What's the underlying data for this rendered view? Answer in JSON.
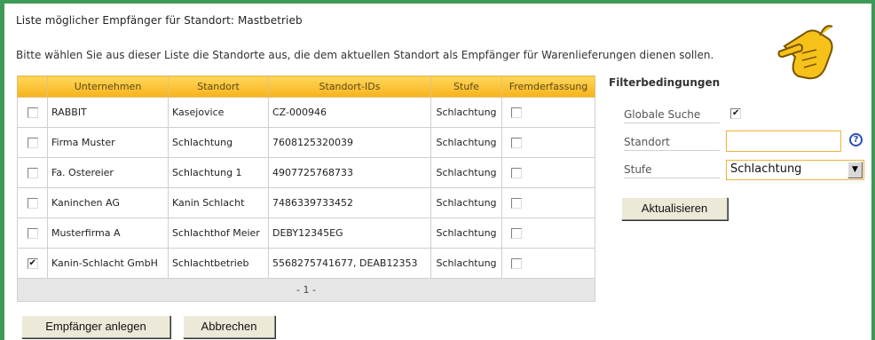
{
  "page": {
    "title": "Liste möglicher Empfänger für Standort: Mastbetrieb",
    "subtitle": "Bitte wählen Sie aus dieser Liste die Standorte aus, die dem aktuellen Standort als Empfänger für Warenlieferungen dienen sollen."
  },
  "table": {
    "headers": [
      "",
      "Unternehmen",
      "Standort",
      "Standort-IDs",
      "Stufe",
      "Fremderfassung"
    ],
    "rows": [
      {
        "selected": false,
        "unternehmen": "RABBIT",
        "standort": "Kasejovice",
        "ids": "CZ-000946",
        "stufe": "Schlachtung",
        "fremd": false
      },
      {
        "selected": false,
        "unternehmen": "Firma Muster",
        "standort": "Schlachtung",
        "ids": "7608125320039",
        "stufe": "Schlachtung",
        "fremd": false
      },
      {
        "selected": false,
        "unternehmen": "Fa. Ostereier",
        "standort": "Schlachtung 1",
        "ids": "4907725768733",
        "stufe": "Schlachtung",
        "fremd": false
      },
      {
        "selected": false,
        "unternehmen": "Kaninchen AG",
        "standort": "Kanin Schlacht",
        "ids": "7486339733452",
        "stufe": "Schlachtung",
        "fremd": false
      },
      {
        "selected": false,
        "unternehmen": "Musterfirma A",
        "standort": "Schlachthof Meier",
        "ids": "DEBY12345EG",
        "stufe": "Schlachtung",
        "fremd": false
      },
      {
        "selected": true,
        "unternehmen": "Kanin-Schlacht GmbH",
        "standort": "Schlachtbetrieb",
        "ids": "5568275741677, DEAB12353",
        "stufe": "Schlachtung",
        "fremd": false
      }
    ],
    "pager": "- 1 -"
  },
  "filter": {
    "title": "Filterbedingungen",
    "global_label": "Globale Suche",
    "global_checked": true,
    "standort_label": "Standort",
    "standort_value": "",
    "stufe_label": "Stufe",
    "stufe_value": "Schlachtung",
    "update_label": "Aktualisieren",
    "help_icon": "help-icon"
  },
  "footer": {
    "create_label": "Empfänger anlegen",
    "cancel_label": "Abbrechen"
  },
  "decor": {
    "pointer_icon": "pointing-hand-icon",
    "accent": "#3e9a57",
    "header_gradient": "#f7b21c"
  }
}
